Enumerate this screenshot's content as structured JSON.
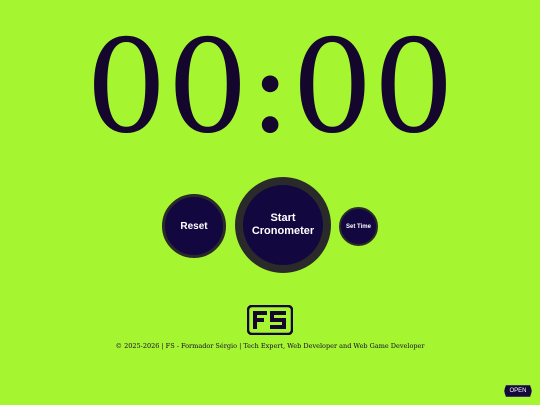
{
  "timer": {
    "display": "00:00"
  },
  "controls": {
    "reset_label": "Reset",
    "start_label": "Start Cronometer",
    "set_time_label": "Set Time"
  },
  "logo": {
    "icon": "fs-logo-icon",
    "text": "FS"
  },
  "footer": {
    "text": "© 2025-2026 | FS - Formador Sérgio | Tech Expert, Web Developer and Web Game Developer"
  },
  "corner": {
    "open_label": "OPEN"
  },
  "colors": {
    "background": "#a6f531",
    "button_fill": "#12083f",
    "button_ring": "#2a2a2a",
    "text_dark": "#14062c"
  }
}
